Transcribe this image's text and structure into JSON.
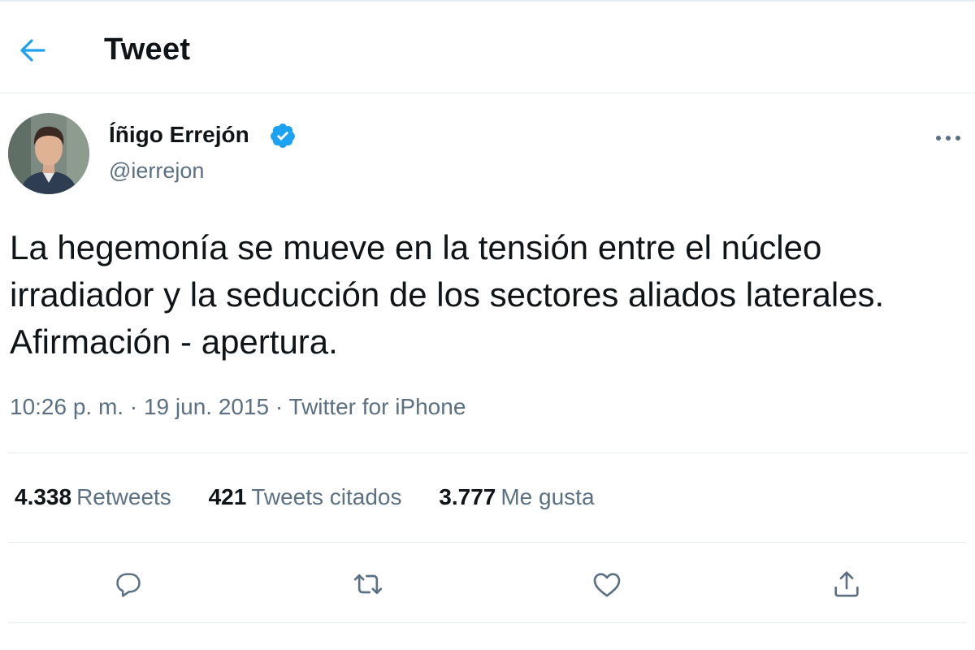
{
  "header": {
    "title": "Tweet",
    "back_icon": "arrow-left-icon",
    "accent": "#1da1f2"
  },
  "author": {
    "name": "Íñigo Errejón",
    "handle": "@ierrejon",
    "verified_icon": "verified-badge-icon",
    "verified_color": "#1da1f2"
  },
  "tweet": {
    "text": "La hegemonía se mueve en la tensión entre el núcleo irradiador y la seducción de los sectores aliados laterales. Afirmación - apertura.",
    "time": "10:26 p. m.",
    "date": "19 jun. 2015",
    "source": "Twitter for iPhone",
    "separator": "·"
  },
  "stats": [
    {
      "count": "4.338",
      "label": "Retweets"
    },
    {
      "count": "421",
      "label": "Tweets citados"
    },
    {
      "count": "3.777",
      "label": "Me gusta"
    }
  ],
  "actions": [
    "reply-icon",
    "retweet-icon",
    "like-icon",
    "share-icon"
  ],
  "colors": {
    "text": "#0f1419",
    "secondary": "#5b7083",
    "border": "#e6ecf0"
  }
}
